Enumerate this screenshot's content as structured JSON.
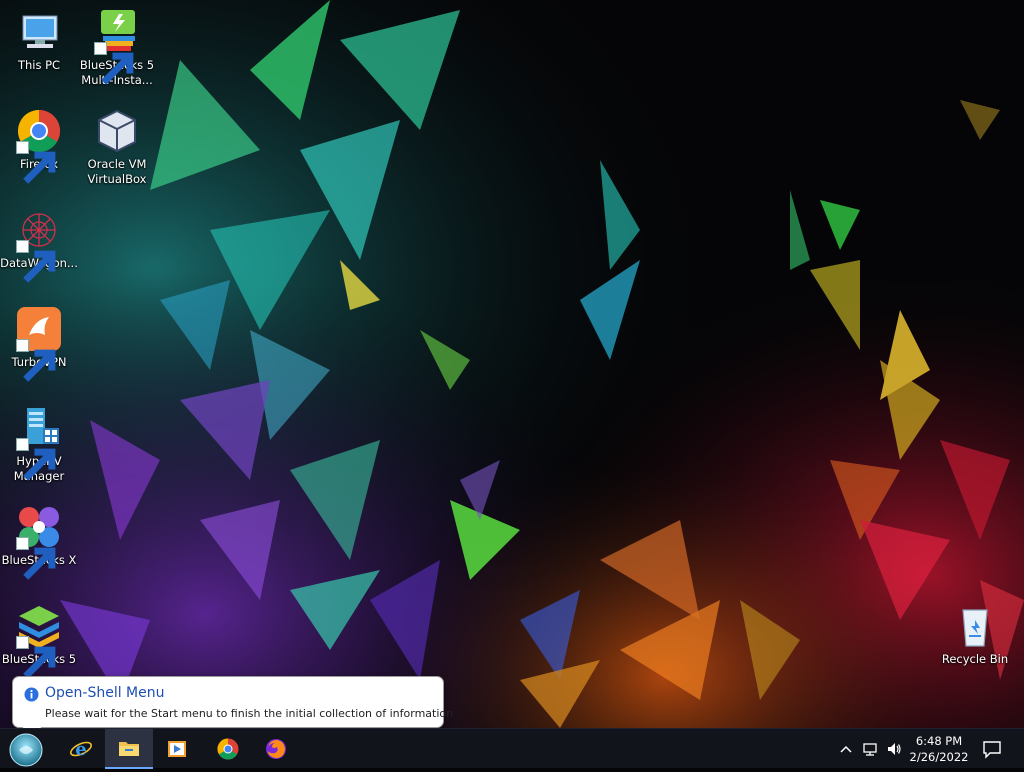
{
  "desktop": {
    "icons": [
      {
        "label": "This PC",
        "icon": "computer-icon"
      },
      {
        "label": "BlueStacks 5 Multi-Insta...",
        "icon": "bluestacks-multi-instance-icon"
      },
      {
        "label": "Firefox",
        "icon": "chrome-icon"
      },
      {
        "label": "Oracle VM VirtualBox",
        "icon": "virtualbox-icon"
      },
      {
        "label": "DataWagon...",
        "icon": "datawagon-icon"
      },
      {
        "label": "TurboVPN",
        "icon": "turbovpn-icon"
      },
      {
        "label": "Hyper-V Manager",
        "icon": "hyperv-manager-icon"
      },
      {
        "label": "BlueStacks X",
        "icon": "bluestacks-x-icon"
      },
      {
        "label": "BlueStacks 5",
        "icon": "bluestacks5-icon"
      },
      {
        "label": "Recycle Bin",
        "icon": "recycle-bin-icon"
      }
    ]
  },
  "notification": {
    "title": "Open-Shell Menu",
    "message": "Please wait for the Start menu to finish the initial collection of information"
  },
  "taskbar": {
    "pinned": [
      {
        "name": "Internet Explorer",
        "icon": "internet-explorer-icon"
      },
      {
        "name": "File Explorer",
        "icon": "folder-icon",
        "active": true
      },
      {
        "name": "Media Player",
        "icon": "media-player-icon"
      },
      {
        "name": "Google Chrome",
        "icon": "chrome-icon"
      },
      {
        "name": "Firefox",
        "icon": "firefox-icon"
      }
    ],
    "tray": [
      "chevron-up-icon",
      "network-icon",
      "volume-icon"
    ],
    "clock": {
      "time": "6:48 PM",
      "date": "2/26/2022"
    }
  },
  "colors": {
    "taskbar": "#12141c",
    "balloon_title": "#1e4fb2",
    "accent": "#6aa8ff"
  }
}
